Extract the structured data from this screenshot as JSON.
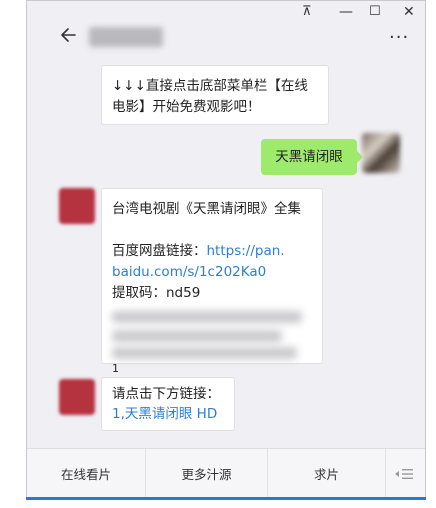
{
  "window": {
    "controls": {
      "pin": "⊼",
      "minimize": "—",
      "maximize": "☐",
      "close": "✕"
    }
  },
  "header": {
    "chat_title": "",
    "more_label": "···"
  },
  "messages": {
    "m1_line1": "↓↓↓直接点击底部菜单栏【在线",
    "m1_line2": "电影】开始免费观影吧！",
    "m2_self": "天黑请闭眼",
    "m3_title": "台湾电视剧《天黑请闭眼》全集",
    "m3_pan_label": "百度网盘链接：",
    "m3_link_part1": "https://pan.",
    "m3_link_part2": "baidu.com/s/1c202Ka0",
    "m3_code": "提取码：nd59",
    "m3_trailing": "1",
    "m4_prompt": "请点击下方链接：",
    "m4_link": "1,天黑请闭眼 HD"
  },
  "menu": {
    "items": [
      "在线看片",
      "更多汁源",
      "求片"
    ],
    "keyboard_icon": "keyboard-toggle-icon"
  },
  "colors": {
    "self_bubble": "#9eea6a",
    "link": "#2b7fd7",
    "background": "#efeff4",
    "taskbar_accent": "#2b78d0"
  }
}
